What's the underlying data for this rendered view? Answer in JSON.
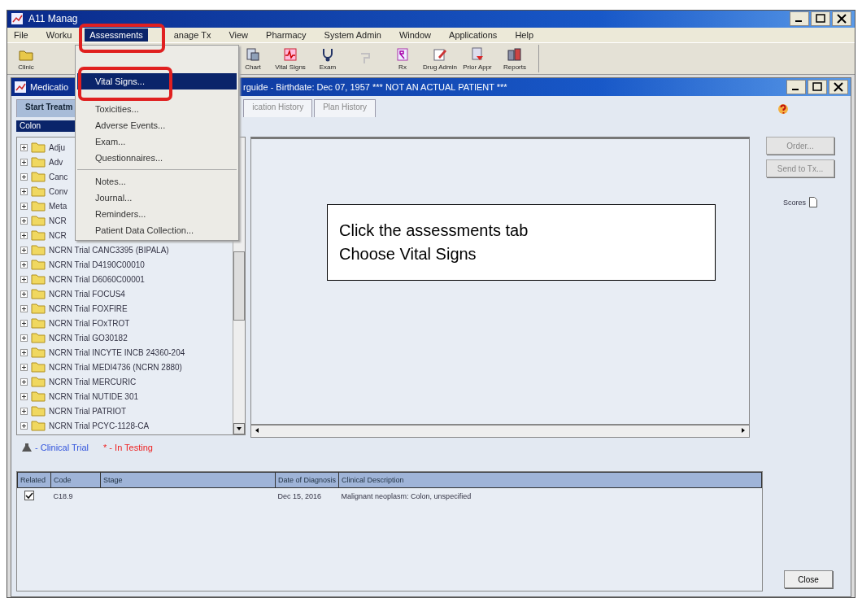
{
  "window": {
    "title": "A11 Manag"
  },
  "menu_bar": [
    {
      "label": "File",
      "selected": false
    },
    {
      "label": "Worku",
      "selected": false
    },
    {
      "label": "Assessments",
      "selected": true
    },
    {
      "label": "anage Tx",
      "selected": false
    },
    {
      "label": "View",
      "selected": false
    },
    {
      "label": "Pharmacy",
      "selected": false
    },
    {
      "label": "System Admin",
      "selected": false
    },
    {
      "label": "Window",
      "selected": false
    },
    {
      "label": "Applications",
      "selected": false
    },
    {
      "label": "Help",
      "selected": false
    }
  ],
  "toolbar": [
    {
      "label": "Clinic",
      "disabled": false
    },
    {
      "label": "Chart",
      "disabled": false
    },
    {
      "label": "Vital Signs",
      "disabled": false
    },
    {
      "label": "Exam",
      "disabled": false
    },
    {
      "disabled": true
    },
    {
      "label": "Rx",
      "disabled": false
    },
    {
      "label": "Drug Admin",
      "disabled": false
    },
    {
      "label": "Prior Appr",
      "disabled": false
    },
    {
      "label": "Reports",
      "disabled": false
    }
  ],
  "assessments_menu": [
    {
      "label": "Vital Signs...",
      "selected": true,
      "kind": "item"
    },
    {
      "kind": "blank"
    },
    {
      "label": "Toxicities...",
      "selected": false,
      "kind": "item"
    },
    {
      "label": "Adverse Events...",
      "selected": false,
      "kind": "item"
    },
    {
      "label": "Exam...",
      "selected": false,
      "kind": "item"
    },
    {
      "label": "Questionnaires...",
      "selected": false,
      "kind": "item"
    },
    {
      "kind": "separator"
    },
    {
      "label": "Notes...",
      "selected": false,
      "kind": "item"
    },
    {
      "label": "Journal...",
      "selected": false,
      "kind": "item"
    },
    {
      "label": "Reminders...",
      "selected": false,
      "kind": "item"
    },
    {
      "label": "Patient Data Collection...",
      "selected": false,
      "kind": "item"
    }
  ],
  "child_window": {
    "title_left": "Medicatio",
    "title_right": "rguide - Birthdate: Dec 07, 1957 *** NOT AN ACTUAL PATIENT ***"
  },
  "tabs": [
    {
      "label": "Start Treatm",
      "selected": true
    },
    {
      "label": "ication History",
      "selected": false
    },
    {
      "label": "Plan History",
      "selected": false
    }
  ],
  "diagnosis_select": {
    "value": "Colon"
  },
  "protocol_tree": [
    {
      "label": "Adju"
    },
    {
      "label": "Adv"
    },
    {
      "label": "Canc"
    },
    {
      "label": "Conv"
    },
    {
      "label": "Meta"
    },
    {
      "label": "NCR"
    },
    {
      "label": "NCR"
    },
    {
      "label": "NCRN Trial CANC3395 (BIPALA)"
    },
    {
      "label": "NCRN Trial D4190C00010"
    },
    {
      "label": "NCRN Trial D6060C00001"
    },
    {
      "label": "NCRN Trial FOCUS4"
    },
    {
      "label": "NCRN Trial FOXFIRE"
    },
    {
      "label": "NCRN Trial FOxTROT"
    },
    {
      "label": "NCRN Trial GO30182"
    },
    {
      "label": "NCRN Trial INCYTE INCB 24360-204"
    },
    {
      "label": "NCRN Trial MEDI4736 (NCRN 2880)"
    },
    {
      "label": "NCRN Trial MERCURIC"
    },
    {
      "label": "NCRN Trial NUTIDE 301"
    },
    {
      "label": "NCRN Trial PATRIOT"
    },
    {
      "label": "NCRN Trial PCYC-1128-CA"
    }
  ],
  "legend": [
    {
      "label": "- Clinical Trial",
      "color": "#3355dd",
      "kind": "icon"
    },
    {
      "label": "* - In Testing",
      "color": "#ee2222",
      "kind": "text"
    }
  ],
  "side_buttons": [
    {
      "label": "Order...",
      "disabled": true
    },
    {
      "label": "Send to Tx...",
      "disabled": true
    }
  ],
  "scores": {
    "label": "Scores"
  },
  "callout": {
    "lines": [
      "Click the assessments tab",
      "Choose Vital Signs"
    ]
  },
  "diagnosis_table": {
    "columns": [
      "Related",
      "Code",
      "Stage",
      "Date of Diagnosis",
      "Clinical Description"
    ],
    "rows": [
      {
        "related": true,
        "code": "C18.9",
        "date": "Dec 15, 2016",
        "description": "Malignant neoplasm: Colon, unspecified"
      }
    ]
  },
  "close_button": {
    "label": "Close"
  }
}
